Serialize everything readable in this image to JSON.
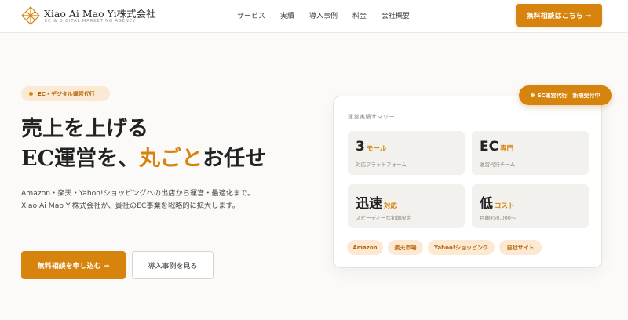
{
  "brand": {
    "name": "Xiao Ai Mao Yi株式会社",
    "subtitle": "EC & DIGITAL MARKETING AGENCY",
    "logo_icon": "diamond-grid-logo-icon",
    "accent_color": "#d6840d"
  },
  "nav": {
    "items": [
      "サービス",
      "実績",
      "導入事例",
      "料金",
      "会社概要"
    ],
    "cta": "無料相談はこちら →"
  },
  "hero": {
    "pill": "EC・デジタル運営代行",
    "title_line1": "売上を上げる",
    "title_line2_pre": "EC運営を、",
    "title_line2_accent": "丸ごと",
    "title_line2_post": "お任せ",
    "description": "Amazon・楽天・Yahoo!ショッピングへの出店から運営・最適化まで。Xiao Ai Mao Yi株式会社が、貴社のEC事業を戦略的に拡大します。",
    "primary_button": "無料相談を申し込む →",
    "secondary_button": "導入事例を見る"
  },
  "summary": {
    "badge": "EC運営代行　新規受付中",
    "title": "運営実績サマリー",
    "stats": [
      {
        "big": "3",
        "unit": "モール",
        "sub": "対応プラットフォーム"
      },
      {
        "big": "EC",
        "unit": "専門",
        "sub": "運営代行チーム"
      },
      {
        "big": "迅速",
        "unit": "対応",
        "sub": "スピーディーな初期設定"
      },
      {
        "big": "低",
        "unit": "コスト",
        "sub": "月額¥50,000〜"
      }
    ],
    "tags": [
      "Amazon",
      "楽天市場",
      "Yahoo!ショッピング",
      "自社サイト"
    ]
  }
}
